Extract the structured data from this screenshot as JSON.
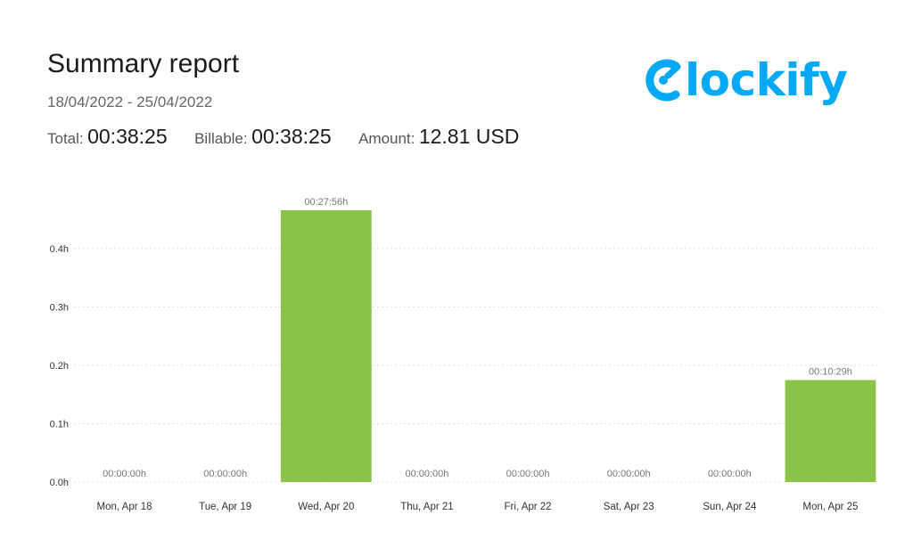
{
  "report": {
    "title": "Summary report",
    "date_range": "18/04/2022 - 25/04/2022",
    "total_label": "Total:",
    "total_value": "00:38:25",
    "billable_label": "Billable:",
    "billable_value": "00:38:25",
    "amount_label": "Amount:",
    "amount_value": "12.81 USD"
  },
  "logo": {
    "text": "Clockify",
    "visible_text": "lockify",
    "color": "#03a9f4"
  },
  "chart_data": {
    "type": "bar",
    "categories": [
      "Mon, Apr 18",
      "Tue, Apr 19",
      "Wed, Apr 20",
      "Thu, Apr 21",
      "Fri, Apr 22",
      "Sat, Apr 23",
      "Sun, Apr 24",
      "Mon, Apr 25"
    ],
    "values": [
      0,
      0,
      0.4656,
      0,
      0,
      0,
      0,
      0.1747
    ],
    "data_labels": [
      "00:00:00h",
      "00:00:00h",
      "00:27:56h",
      "00:00:00h",
      "00:00:00h",
      "00:00:00h",
      "00:00:00h",
      "00:10:29h"
    ],
    "y_ticks": [
      0,
      0.1,
      0.2,
      0.3,
      0.4
    ],
    "y_tick_labels": [
      "0.0h",
      "0.1h",
      "0.2h",
      "0.3h",
      "0.4h"
    ],
    "ylim": [
      0,
      0.4656
    ],
    "grid": true,
    "bar_color": "#8bc34a",
    "grid_color": "#e2e2e2",
    "label_color": "#777777"
  }
}
